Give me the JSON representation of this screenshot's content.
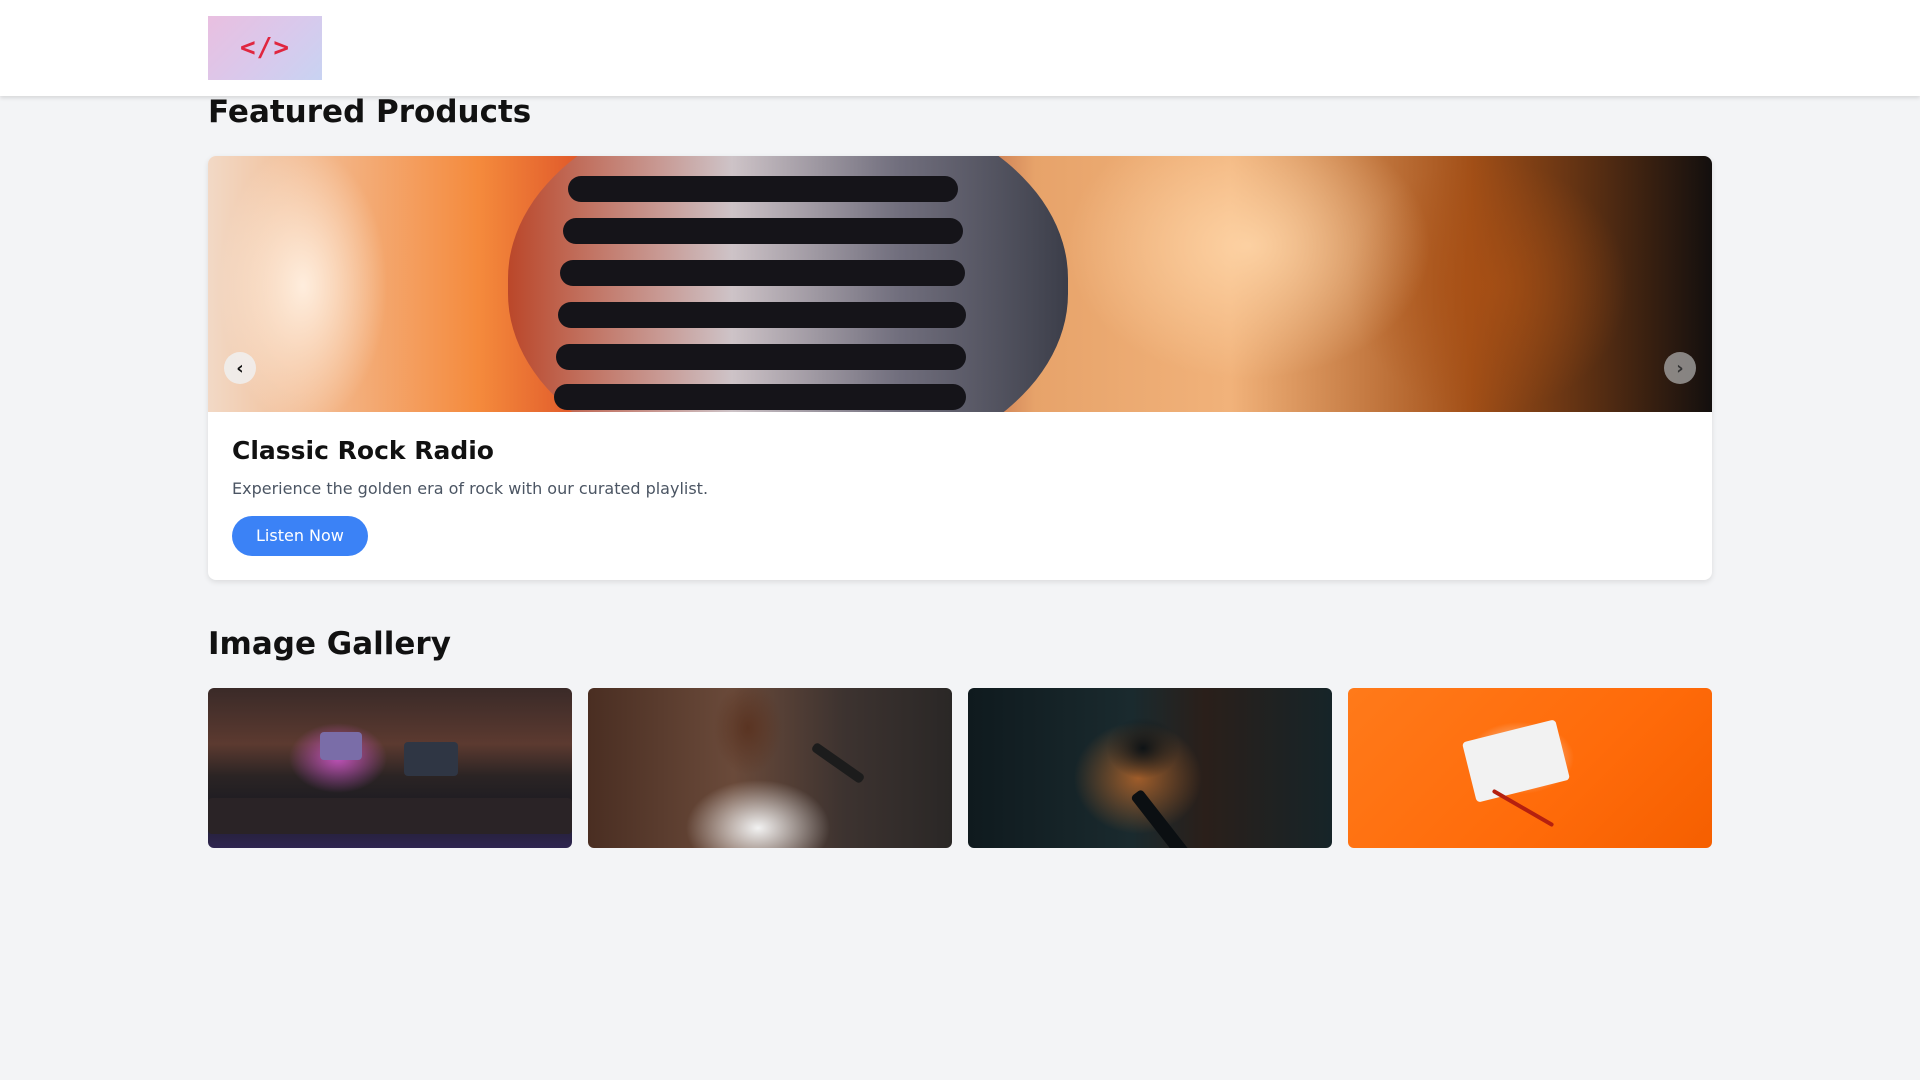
{
  "header": {
    "logo_icon": "code-brackets-icon",
    "logo_text": "</>"
  },
  "featured": {
    "title": "Featured Products",
    "slide": {
      "image_icon": "vintage-microphone-image",
      "title": "Classic Rock Radio",
      "description": "Experience the golden era of rock with our curated playlist.",
      "button_label": "Listen Now"
    },
    "prev_icon": "chevron-left-icon",
    "next_icon": "chevron-right-icon",
    "prev_glyph": "‹",
    "next_glyph": "›"
  },
  "gallery": {
    "title": "Image Gallery",
    "images": [
      {
        "image": "recording-studio-image"
      },
      {
        "image": "man-with-headphones-image"
      },
      {
        "image": "microphone-image"
      },
      {
        "image": "cassette-tape-image"
      }
    ]
  },
  "colors": {
    "accent": "#3b82f6",
    "background": "#f3f4f6",
    "logo_red": "#e0263f"
  }
}
